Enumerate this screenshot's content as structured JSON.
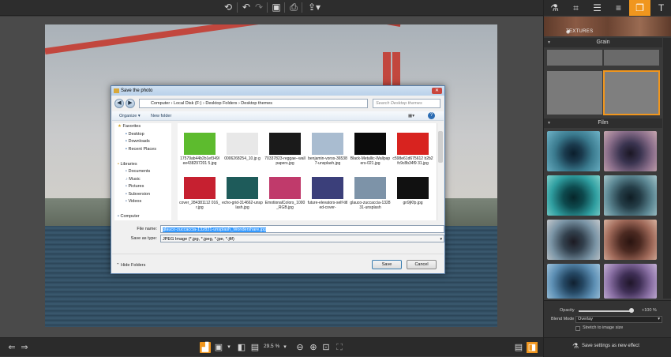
{
  "toolbar": {
    "undo_icon": "undo-icon",
    "save_icon": "save-icon",
    "print_icon": "print-icon",
    "share_icon": "share-icon"
  },
  "dialog": {
    "title": "Save the photo",
    "address": "Computer › Local Disk (F:) › Desktop Folders › Desktop themes",
    "search_placeholder": "Search Desktop themes",
    "organize": "Organize ▾",
    "new_folder": "New folder",
    "nav": [
      {
        "label": "Favorites",
        "level": 0
      },
      {
        "label": "Desktop",
        "level": 1
      },
      {
        "label": "Downloads",
        "level": 1
      },
      {
        "label": "Recent Places",
        "level": 1
      },
      {
        "label": "",
        "level": 0
      },
      {
        "label": "Libraries",
        "level": 0
      },
      {
        "label": "Documents",
        "level": 1
      },
      {
        "label": "Music",
        "level": 1
      },
      {
        "label": "Pictures",
        "level": 1
      },
      {
        "label": "Subversion",
        "level": 1
      },
      {
        "label": "Videos",
        "level": 1
      },
      {
        "label": "",
        "level": 0
      },
      {
        "label": "Computer",
        "level": 0
      }
    ],
    "files": [
      {
        "name": "17579ab44b2b1ef349lee438297201 5.jpg",
        "color": "#5dbb2e"
      },
      {
        "name": "0006268254_10.jp g",
        "color": "#e8e8e8"
      },
      {
        "name": "70337823-reggae--wallpapers.jpg",
        "color": "#1a1a1a"
      },
      {
        "name": "benjamin-voros-365387-unsplash.jpg",
        "color": "#a9bcd0"
      },
      {
        "name": "Black-Metallic-Wallpapers-021.jpg",
        "color": "#0b0b0b"
      },
      {
        "name": "c598e61d675612 b2b2fc9c8b34f9 31.jpg",
        "color": "#d8231f"
      },
      {
        "name": "cover_284381112 016_r.jpg",
        "color": "#c62030"
      },
      {
        "name": "echo-grid-314662-unsplash.jpg",
        "color": "#1e5b5a"
      },
      {
        "name": "EmotionalColors_1000_RGB.jpg",
        "color": "#c03a6b"
      },
      {
        "name": "future-elevators-self-titled-cover-",
        "color": "#3b3f7a"
      },
      {
        "name": "glauco-zuccaccia-132831-unsplash",
        "color": "#7d93a8"
      },
      {
        "name": "gn9jKfp.jpg",
        "color": "#111111"
      }
    ],
    "file_name_label": "File name:",
    "file_name_value": "glauco-zuccaccia-132831-unsplash_Wondershare.jpg",
    "save_as_label": "Save as type:",
    "save_as_value": "JPEG Image (*.jpg, *.jpeg, *.jpe, *.jfif)",
    "hide_folders": "Hide Folders",
    "save_button": "Save",
    "cancel_button": "Cancel"
  },
  "side": {
    "textures_label": "TEXTURES",
    "grain_label": "Grain",
    "film_label": "Film",
    "opacity_label": "Opacity",
    "opacity_value": "+100 %",
    "opacity_fraction": 0.95,
    "blend_label": "Blend Mode",
    "blend_value": "Overlay",
    "stretch_label": "Stretch to image size",
    "save_settings": "Save settings as new effect"
  },
  "bottom": {
    "zoom": "29.5 %"
  },
  "colors": {
    "accent": "#f0961e",
    "panel": "#3a3a3a"
  }
}
